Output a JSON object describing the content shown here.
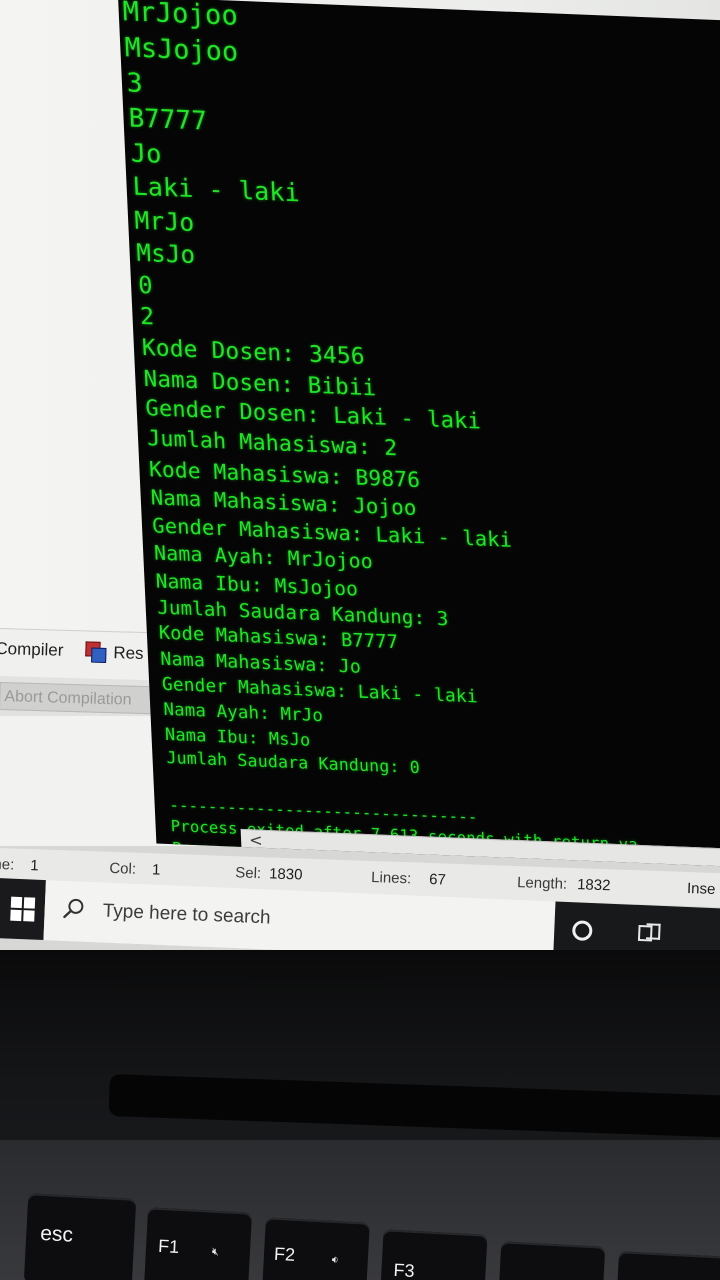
{
  "console": {
    "lines": [
      "MrJojoo",
      "MsJojoo",
      "3",
      "B7777",
      "Jo",
      "Laki - laki",
      "MrJo",
      "MsJo",
      "0",
      "2",
      "Kode Dosen: 3456",
      "Nama Dosen: Bibii",
      "Gender Dosen: Laki - laki",
      "Jumlah Mahasiswa: 2",
      "Kode Mahasiswa: B9876",
      "Nama Mahasiswa: Jojoo",
      "Gender Mahasiswa: Laki - laki",
      "Nama Ayah: MrJojoo",
      "Nama Ibu: MsJojoo",
      "Jumlah Saudara Kandung: 3",
      "Kode Mahasiswa: B7777",
      "Nama Mahasiswa: Jo",
      "Gender Mahasiswa: Laki - laki",
      "Nama Ayah: MrJo",
      "Nama Ibu: MsJo",
      "Jumlah Saudara Kandung: 0",
      "",
      "--------------------------------",
      "Process exited after 7.613 seconds with return va",
      "Press any key to continue . . ."
    ],
    "text_color": "#1ee626",
    "background": "#050505",
    "scroll_left_arrow": "<"
  },
  "ide": {
    "tabs": [
      {
        "label": "Compiler",
        "icon": "compiler-tab-icon"
      },
      {
        "label": "Res",
        "icon": "resources-tab-icon"
      }
    ],
    "abort_button": "Abort Compilation",
    "status": {
      "line_label": "ne:",
      "line_value": "1",
      "col_label": "Col:",
      "col_value": "1",
      "sel_label": "Sel:",
      "sel_value": "1830",
      "lines_label": "Lines:",
      "lines_value": "67",
      "length_label": "Length:",
      "length_value": "1832",
      "insert_label": "Inse"
    }
  },
  "taskbar": {
    "search_placeholder": "Type here to search",
    "start_icon": "windows-logo-icon",
    "cortana_icon": "cortana-circle-icon",
    "taskview_icon": "task-view-icon"
  },
  "keyboard": {
    "esc": "esc",
    "f1": "F1",
    "f1_icon": "mute-icon",
    "f2": "F2",
    "f2_icon": "volume-down-icon",
    "f3": "F3"
  }
}
